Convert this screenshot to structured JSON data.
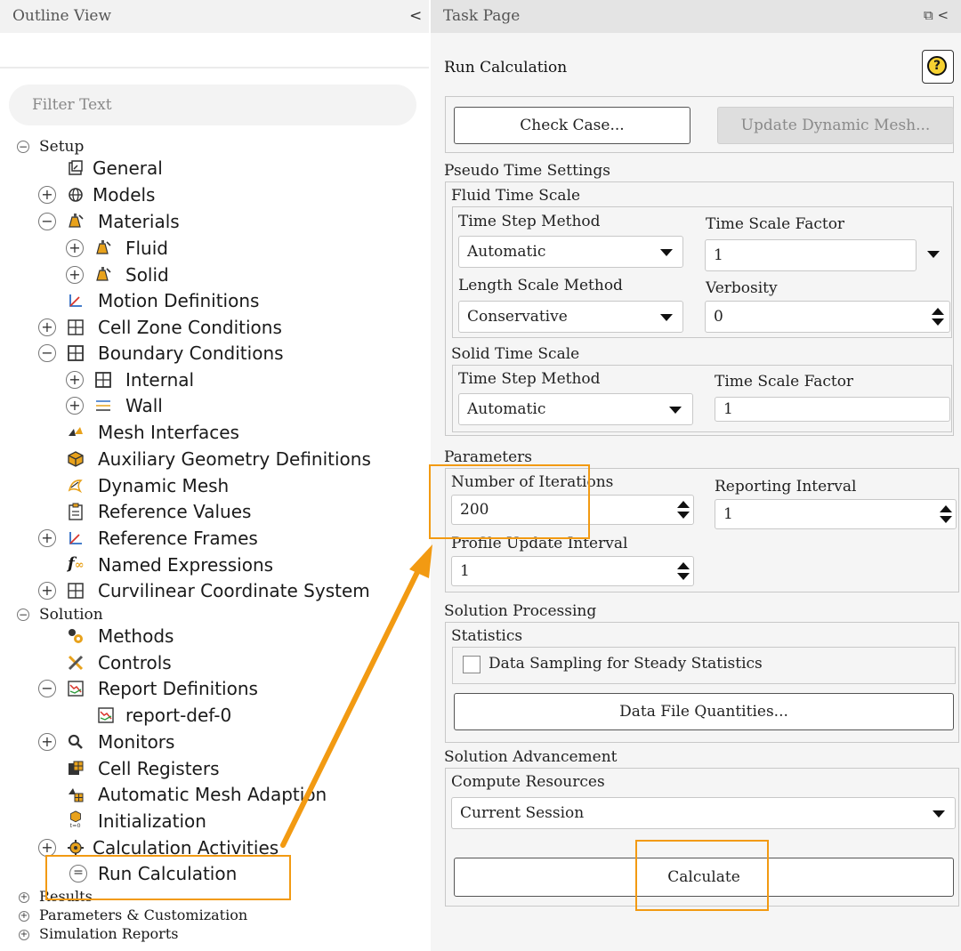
{
  "outline": {
    "title": "Outline View",
    "collapse_glyph": "<",
    "filter_placeholder": "Filter Text",
    "tree": {
      "setup": "Setup",
      "general": "General",
      "models": "Models",
      "materials": "Materials",
      "fluid": "Fluid",
      "solid": "Solid",
      "motion_definitions": "Motion Definitions",
      "cell_zone_conditions": "Cell Zone Conditions",
      "boundary_conditions": "Boundary Conditions",
      "internal": "Internal",
      "wall": "Wall",
      "mesh_interfaces": "Mesh Interfaces",
      "auxiliary_geometry": "Auxiliary Geometry Definitions",
      "dynamic_mesh": "Dynamic Mesh",
      "reference_values": "Reference Values",
      "reference_frames": "Reference Frames",
      "named_expressions": "Named Expressions",
      "curvilinear": "Curvilinear Coordinate System",
      "solution": "Solution",
      "methods": "Methods",
      "controls": "Controls",
      "report_definitions": "Report Definitions",
      "report_def_0": "report-def-0",
      "monitors": "Monitors",
      "cell_registers": "Cell Registers",
      "automatic_mesh_adaption": "Automatic Mesh Adaption",
      "initialization": "Initialization",
      "calculation_activities": "Calculation Activities",
      "run_calculation": "Run Calculation",
      "results": "Results",
      "parameters_customization": "Parameters & Customization",
      "simulation_reports": "Simulation Reports"
    }
  },
  "task": {
    "title": "Task Page",
    "header_icons": "⧉ <",
    "heading": "Run Calculation",
    "help": "?",
    "check_case": "Check Case...",
    "update_dynamic_mesh": "Update Dynamic Mesh...",
    "pseudo_time_settings": "Pseudo Time Settings",
    "fluid_time_scale": {
      "label": "Fluid Time Scale",
      "time_step_method_label": "Time Step Method",
      "time_step_method_value": "Automatic",
      "time_scale_factor_label": "Time Scale Factor",
      "time_scale_factor_value": "1",
      "length_scale_method_label": "Length Scale Method",
      "length_scale_method_value": "Conservative",
      "verbosity_label": "Verbosity",
      "verbosity_value": "0"
    },
    "solid_time_scale": {
      "label": "Solid Time Scale",
      "time_step_method_label": "Time Step Method",
      "time_step_method_value": "Automatic",
      "time_scale_factor_label": "Time Scale Factor",
      "time_scale_factor_value": "1"
    },
    "parameters": {
      "label": "Parameters",
      "iterations_label": "Number of Iterations",
      "iterations_value": "200",
      "reporting_interval_label": "Reporting Interval",
      "reporting_interval_value": "1",
      "profile_update_label": "Profile Update Interval",
      "profile_update_value": "1"
    },
    "solution_processing": {
      "label": "Solution Processing",
      "statistics_label": "Statistics",
      "data_sampling_label": "Data Sampling for Steady Statistics",
      "data_sampling_checked": false,
      "data_file_quantities": "Data File Quantities..."
    },
    "solution_advancement": {
      "label": "Solution Advancement",
      "compute_resources_label": "Compute Resources",
      "compute_resources_value": "Current Session",
      "calculate": "Calculate"
    }
  },
  "annotations": {
    "highlight_color": "#f29a12"
  }
}
